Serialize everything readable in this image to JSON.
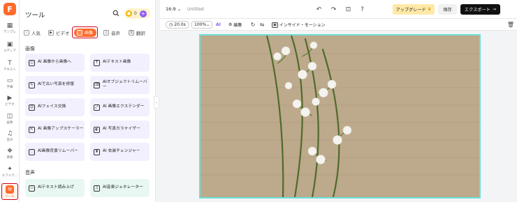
{
  "app": {
    "logo_letter": "F"
  },
  "rail": {
    "items": [
      {
        "label": "テンプレ",
        "icon": "template-icon"
      },
      {
        "label": "メディア",
        "icon": "media-icon"
      },
      {
        "label": "テキスト",
        "icon": "text-icon"
      },
      {
        "label": "字幕",
        "icon": "caption-icon"
      },
      {
        "label": "ビデオ",
        "icon": "video-icon"
      },
      {
        "label": "画像",
        "icon": "image-icon"
      },
      {
        "label": "音声",
        "icon": "audio-icon"
      },
      {
        "label": "要素",
        "icon": "elements-icon"
      },
      {
        "label": "エフェク…",
        "icon": "effects-icon"
      },
      {
        "label": "ツール",
        "icon": "tools-icon"
      }
    ]
  },
  "panel": {
    "title": "ツール",
    "credits": "0",
    "tabs": [
      {
        "label": "人気"
      },
      {
        "label": "ビデオ"
      },
      {
        "label": "画像"
      },
      {
        "label": "音声"
      },
      {
        "label": "翻訳"
      }
    ],
    "section_image": "画像",
    "image_tools": [
      "AI 画像から画像へ",
      "AIテキスト画像",
      "AIで古い写真を修復",
      "AIオブジェクトリムーバー",
      "AIフェイス交換",
      "AI 画像エクステンダー",
      "AI 画像アップスケーラー",
      "AI 写真カラナイザー",
      "AI画像背景リムーバー",
      "AI 衣装チェンジャー"
    ],
    "section_audio": "音声",
    "audio_tools": [
      "AIテキスト読み上げ",
      "AI音楽ジェネレーター"
    ]
  },
  "header": {
    "ratio": "16:9",
    "doc_title": "Untitled",
    "upgrade_label": "アップグレード",
    "save_label": "保存",
    "export_label": "エクスポート"
  },
  "toolbar": {
    "duration": "20.0s",
    "zoom": "100%",
    "ai_label": "AI",
    "edit_label": "編集",
    "motion_label": "インサイド・モーション"
  },
  "colors": {
    "brand": "#ff6b2c",
    "canvas_border": "#6fe0d6",
    "tool_card_image": "#f2f0fe",
    "tool_card_audio": "#e8f7f2"
  }
}
